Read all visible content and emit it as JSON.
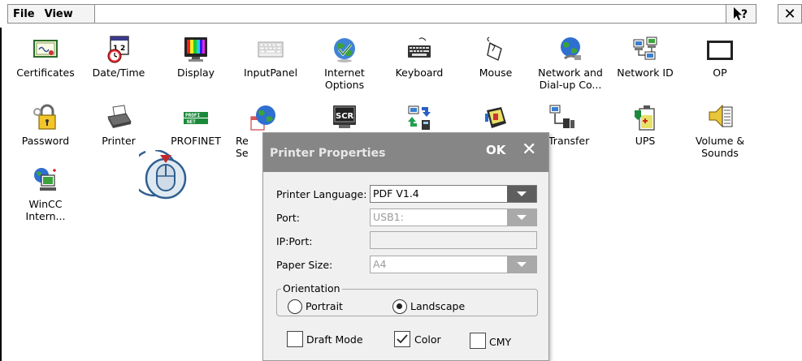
{
  "menubar": {
    "file": "File",
    "view": "View",
    "help_icon": "help-arrow-question-icon",
    "close_glyph": "✕"
  },
  "icons": [
    {
      "name": "certificates",
      "label": "Certificates",
      "icon": "certificate-icon"
    },
    {
      "name": "datetime",
      "label": "Date/Time",
      "icon": "calendar-clock-icon"
    },
    {
      "name": "display",
      "label": "Display",
      "icon": "monitor-icon"
    },
    {
      "name": "inputpanel",
      "label": "InputPanel",
      "icon": "keyboard-panel-icon"
    },
    {
      "name": "internet-options",
      "label": "Internet\nOptions",
      "icon": "globe-check-icon"
    },
    {
      "name": "keyboard",
      "label": "Keyboard",
      "icon": "keyboard-icon"
    },
    {
      "name": "mouse",
      "label": "Mouse",
      "icon": "mouse-icon"
    },
    {
      "name": "network-dialup",
      "label": "Network and\nDial-up Co...",
      "icon": "network-globe-icon"
    },
    {
      "name": "network-id",
      "label": "Network ID",
      "icon": "network-computers-icon"
    },
    {
      "name": "op",
      "label": "OP",
      "icon": "op-panel-icon"
    },
    {
      "name": "password",
      "label": "Password",
      "icon": "padlock-key-icon"
    },
    {
      "name": "printer",
      "label": "Printer",
      "icon": "printer-icon"
    },
    {
      "name": "profinet",
      "label": "PROFINET",
      "icon": "profinet-icon"
    },
    {
      "name": "regional",
      "label": "Re\nSe",
      "icon": "regional-globe-calendar-icon"
    },
    {
      "name": "screensaver",
      "label": "",
      "icon": "scr-icon"
    },
    {
      "name": "transfer-arrows",
      "label": "",
      "icon": "transfer-arrows-icon"
    },
    {
      "name": "sound-device",
      "label": "",
      "icon": "device-icon"
    },
    {
      "name": "transfer",
      "label": "Transfer",
      "icon": "transfer-computer-icon"
    },
    {
      "name": "ups",
      "label": "UPS",
      "icon": "ups-battery-icon"
    },
    {
      "name": "volume-sounds",
      "label": "Volume &\nSounds",
      "icon": "speaker-icon"
    },
    {
      "name": "wincc-internet",
      "label": "WinCC\nIntern...",
      "icon": "wincc-computer-globe-icon"
    }
  ],
  "dialog": {
    "title": "Printer Properties",
    "ok": "OK",
    "close": "✕",
    "printer_language_label": "Printer Language:",
    "printer_language_value": "PDF V1.4",
    "port_label": "Port:",
    "port_value": "USB1:",
    "ipport_label": "IP:Port:",
    "ipport_value": "",
    "paper_size_label": "Paper Size:",
    "paper_size_value": "A4",
    "orientation_label": "Orientation",
    "portrait_label": "Portrait",
    "landscape_label": "Landscape",
    "orientation_selected": "Landscape",
    "draft_mode_label": "Draft Mode",
    "draft_mode_checked": false,
    "color_label": "Color",
    "color_checked": true,
    "cmy_label": "CMY",
    "cmy_checked": false
  },
  "colors": {
    "dialog_title_bg": "#868686",
    "combo_arrow_bg": "#5e5e5e",
    "touch_pointer_red": "#c0282d",
    "touch_pointer_fill": "#dfe9f2"
  }
}
